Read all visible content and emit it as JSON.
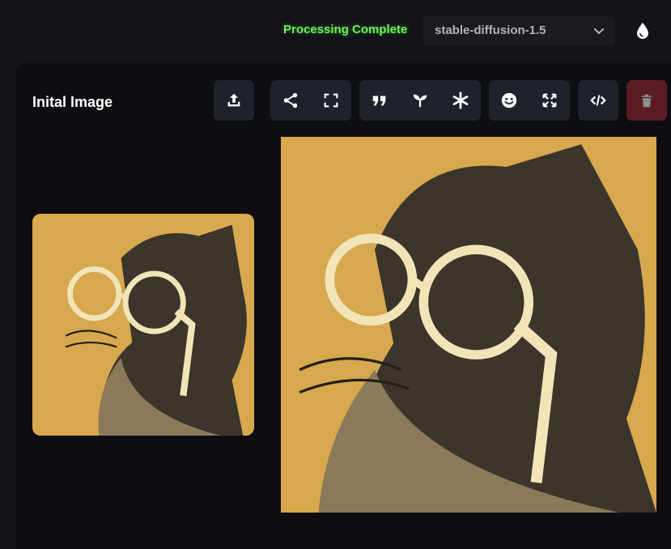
{
  "header": {
    "status": "Processing Complete",
    "model": "stable-diffusion-1.5"
  },
  "panel": {
    "title": "Inital Image"
  },
  "toolbar": {
    "groups": [
      [
        "upload-icon"
      ],
      [
        "share-icon",
        "fullscreen-icon"
      ],
      [
        "quote-icon",
        "sprout-icon",
        "asterisk-icon"
      ],
      [
        "face-icon",
        "expand-icon"
      ],
      [
        "code-icon"
      ],
      [
        "trash-icon"
      ]
    ]
  },
  "images": {
    "initial": "cat wearing round glasses, sepia sketch",
    "result": "cat wearing round glasses, sepia sketch"
  },
  "colors": {
    "status_green": "#6ef05a",
    "background": "#131318",
    "panel": "#0e0e12",
    "button": "#20222b",
    "delete_button": "#5a1c20",
    "sepia": "#d7a84e"
  }
}
